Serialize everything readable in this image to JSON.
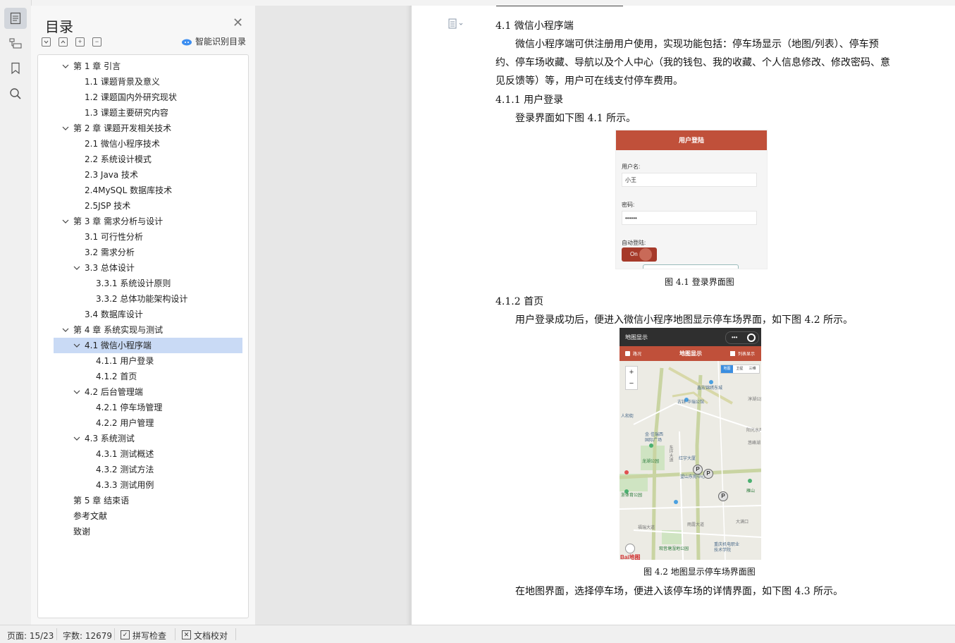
{
  "toc": {
    "title": "目录",
    "smart_label": "智能识别目录",
    "items": [
      {
        "text": "第 1 章  引言",
        "level": 0,
        "chev": "open"
      },
      {
        "text": "1.1  课题背景及意义",
        "level": 1
      },
      {
        "text": "1.2  课题国内外研究现状",
        "level": 1
      },
      {
        "text": "1.3  课题主要研究内容",
        "level": 1
      },
      {
        "text": "第 2 章  课题开发相关技术",
        "level": 0,
        "chev": "open"
      },
      {
        "text": "2.1  微信小程序技术",
        "level": 1
      },
      {
        "text": "2.2  系统设计模式",
        "level": 1
      },
      {
        "text": "2.3 Java 技术",
        "level": 1
      },
      {
        "text": "2.4MySQL 数据库技术",
        "level": 1
      },
      {
        "text": "2.5JSP 技术",
        "level": 1
      },
      {
        "text": "第 3 章  需求分析与设计",
        "level": 0,
        "chev": "open"
      },
      {
        "text": "3.1  可行性分析",
        "level": 1
      },
      {
        "text": "3.2  需求分析",
        "level": 1
      },
      {
        "text": "3.3  总体设计",
        "level": 1,
        "chev": "open"
      },
      {
        "text": "3.3.1  系统设计原则",
        "level": 2
      },
      {
        "text": "3.3.2  总体功能架构设计",
        "level": 2
      },
      {
        "text": "3.4 数据库设计",
        "level": 1
      },
      {
        "text": "第 4 章  系统实现与测试",
        "level": 0,
        "chev": "open"
      },
      {
        "text": "4.1  微信小程序端",
        "level": 1,
        "chev": "open",
        "selected": true
      },
      {
        "text": "4.1.1  用户登录",
        "level": 2
      },
      {
        "text": "4.1.2 首页",
        "level": 2
      },
      {
        "text": "4.2  后台管理端",
        "level": 1,
        "chev": "open"
      },
      {
        "text": "4.2.1  停车场管理",
        "level": 2
      },
      {
        "text": "4.2.2  用户管理",
        "level": 2
      },
      {
        "text": "4.3  系统测试",
        "level": 1,
        "chev": "open"
      },
      {
        "text": "4.3.1  测试概述",
        "level": 2
      },
      {
        "text": "4.3.2  测试方法",
        "level": 2
      },
      {
        "text": "4.3.3  测试用例",
        "level": 2
      },
      {
        "text": "第 5 章  结束语",
        "level": 0
      },
      {
        "text": "参考文献",
        "level": 0
      },
      {
        "text": "致谢",
        "level": 0
      }
    ]
  },
  "doc": {
    "h_4_1": "4.1  微信小程序端",
    "p1_l1": "微信小程序端可供注册用户使用，实现功能包括：停车场显示（地图/列表）、停车预",
    "p1_l2": "约、停车场收藏、导航以及个人中心（我的钱包、我的收藏、个人信息修改、修改密码、意",
    "p1_l3": "见反馈等）等，用户可在线支付停车费用。",
    "h_4_1_1": "4.1.1 用户登录",
    "p2": "登录界面如下图 4.1 所示。",
    "cap1": "图 4.1  登录界面图",
    "h_4_1_2": "4.1.2 首页",
    "p3": "用户登录成功后，便进入微信小程序地图显示停车场界面，如下图 4.2 所示。",
    "cap2": "图 4.2  地图显示停车场界面图",
    "p4": "在地图界面，选择停车场，便进入该停车场的详情界面，如下图 4.3 所示。"
  },
  "login_fig": {
    "bar_title": "用户登陆",
    "username_label": "用户名:",
    "username_value": "小王",
    "password_label": "密码:",
    "password_value": "••••••",
    "auto_label": "自动登陆:",
    "toggle_text": "On"
  },
  "map_fig": {
    "title": "地图显示",
    "nav_left": "路况",
    "nav_center": "地图显示",
    "nav_right": "列表显示",
    "mode_map": "地图",
    "mode_sat": "卫星",
    "mode_3d": "三维",
    "zoom_in": "+",
    "zoom_out": "−",
    "labels": [
      "鑫宏锦绣东城",
      "古钰·华瑞公馆",
      "人和街",
      "阳光水岸",
      "金·佳瑞西",
      "国际广场",
      "龙湖公园",
      "红宇大厦",
      "东环大道",
      "望山东苑中心",
      "浙体育公园",
      "福瑞大道",
      "观音塘湿地公园",
      "重庆机电职业",
      "技术学院",
      "大满口",
      "雁山",
      "雨露大道",
      "淳湖公园",
      "悠峰湖"
    ],
    "parking_mark": "P",
    "logo": "Bai地图"
  },
  "status": {
    "page": "页面: 15/23",
    "words": "字数: 12679",
    "spell": "拼写检查",
    "proof": "文档校对"
  },
  "colors": {
    "selection": "#c9daf5",
    "login_bar": "#c0503a",
    "map_nav": "#c0503a",
    "toggle": "#a63a2a"
  }
}
